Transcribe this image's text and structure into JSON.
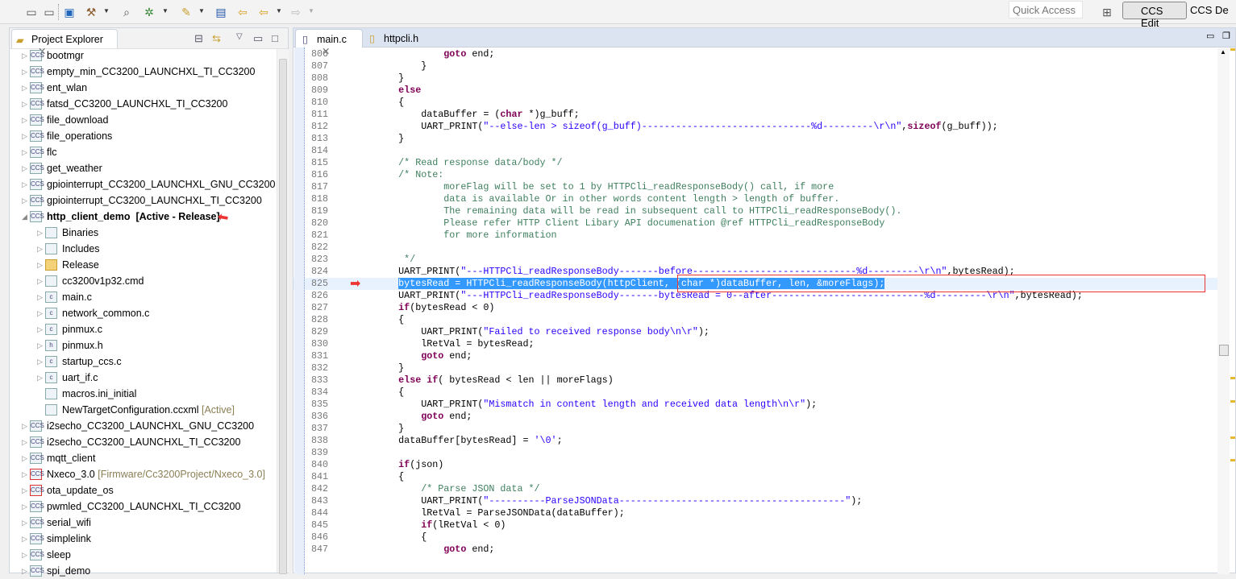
{
  "toolbar": {
    "quick_access": "Quick Access",
    "perspective_active": "CCS Edit",
    "perspective_other": "CCS De"
  },
  "explorer": {
    "title": "Project Explorer",
    "items": [
      {
        "label": "bootmgr",
        "level": 0,
        "icon": "ccs-project-icon"
      },
      {
        "label": "empty_min_CC3200_LAUNCHXL_TI_CC3200",
        "level": 0,
        "icon": "ccs-project-icon"
      },
      {
        "label": "ent_wlan",
        "level": 0,
        "icon": "ccs-project-icon"
      },
      {
        "label": "fatsd_CC3200_LAUNCHXL_TI_CC3200",
        "level": 0,
        "icon": "ccs-project-icon"
      },
      {
        "label": "file_download",
        "level": 0,
        "icon": "ccs-project-icon"
      },
      {
        "label": "file_operations",
        "level": 0,
        "icon": "ccs-project-icon"
      },
      {
        "label": "flc",
        "level": 0,
        "icon": "ccs-project-icon"
      },
      {
        "label": "get_weather",
        "level": 0,
        "icon": "ccs-project-icon"
      },
      {
        "label": "gpiointerrupt_CC3200_LAUNCHXL_GNU_CC3200",
        "level": 0,
        "icon": "ccs-project-icon"
      },
      {
        "label": "gpiointerrupt_CC3200_LAUNCHXL_TI_CC3200",
        "level": 0,
        "icon": "ccs-project-icon"
      },
      {
        "label": "http_client_demo",
        "suffix": "[Active - Release]",
        "level": 0,
        "icon": "ccs-project-icon",
        "expanded": true,
        "bold": true
      },
      {
        "label": "Binaries",
        "level": 1,
        "icon": "binaries-icon"
      },
      {
        "label": "Includes",
        "level": 1,
        "icon": "includes-icon"
      },
      {
        "label": "Release",
        "level": 1,
        "icon": "folder-icon"
      },
      {
        "label": "cc3200v1p32.cmd",
        "level": 1,
        "icon": "cmd-file-icon"
      },
      {
        "label": "main.c",
        "level": 1,
        "icon": "c-file-icon"
      },
      {
        "label": "network_common.c",
        "level": 1,
        "icon": "c-file-icon"
      },
      {
        "label": "pinmux.c",
        "level": 1,
        "icon": "c-file-icon"
      },
      {
        "label": "pinmux.h",
        "level": 1,
        "icon": "h-file-icon"
      },
      {
        "label": "startup_ccs.c",
        "level": 1,
        "icon": "c-file-icon"
      },
      {
        "label": "uart_if.c",
        "level": 1,
        "icon": "c-file-icon"
      },
      {
        "label": "macros.ini_initial",
        "level": 1,
        "icon": "file-icon",
        "leaf": true
      },
      {
        "label": "NewTargetConfiguration.ccxml",
        "suffix": "[Active]",
        "level": 1,
        "icon": "ccxml-file-icon",
        "leaf": true
      },
      {
        "label": "i2secho_CC3200_LAUNCHXL_GNU_CC3200",
        "level": 0,
        "icon": "ccs-project-icon"
      },
      {
        "label": "i2secho_CC3200_LAUNCHXL_TI_CC3200",
        "level": 0,
        "icon": "ccs-project-icon"
      },
      {
        "label": "mqtt_client",
        "level": 0,
        "icon": "ccs-project-icon"
      },
      {
        "label": "Nxeco_3.0",
        "suffix": "[Firmware/Cc3200Project/Nxeco_3.0]",
        "level": 0,
        "icon": "ccs-project-error-icon"
      },
      {
        "label": "ota_update_os",
        "level": 0,
        "icon": "ccs-project-error-icon"
      },
      {
        "label": "pwmled_CC3200_LAUNCHXL_TI_CC3200",
        "level": 0,
        "icon": "ccs-project-icon"
      },
      {
        "label": "serial_wifi",
        "level": 0,
        "icon": "ccs-project-icon"
      },
      {
        "label": "simplelink",
        "level": 0,
        "icon": "ccs-project-icon"
      },
      {
        "label": "sleep",
        "level": 0,
        "icon": "ccs-project-icon"
      },
      {
        "label": "spi_demo",
        "level": 0,
        "icon": "ccs-project-icon"
      }
    ]
  },
  "editor": {
    "tabs": [
      "main.c",
      "httpcli.h"
    ],
    "current_line": 825,
    "lines": [
      {
        "n": 806,
        "seg": [
          [
            "",
            "                    "
          ],
          [
            "k",
            "goto"
          ],
          [
            "",
            " end;"
          ]
        ]
      },
      {
        "n": 807,
        "seg": [
          [
            "",
            "                }"
          ]
        ]
      },
      {
        "n": 808,
        "seg": [
          [
            "",
            "            }"
          ]
        ]
      },
      {
        "n": 809,
        "seg": [
          [
            "",
            "            "
          ],
          [
            "k",
            "else"
          ]
        ]
      },
      {
        "n": 810,
        "seg": [
          [
            "",
            "            {"
          ]
        ]
      },
      {
        "n": 811,
        "seg": [
          [
            "",
            "                dataBuffer = ("
          ],
          [
            "k",
            "char"
          ],
          [
            "",
            " *)g_buff;"
          ]
        ]
      },
      {
        "n": 812,
        "seg": [
          [
            "",
            "                UART_PRINT("
          ],
          [
            "s",
            "\"--else-len > sizeof(g_buff)------------------------------%d---------\\r\\n\""
          ],
          [
            "",
            ","
          ],
          [
            "k",
            "sizeof"
          ],
          [
            "",
            "(g_buff));"
          ]
        ]
      },
      {
        "n": 813,
        "seg": [
          [
            "",
            "            }"
          ]
        ]
      },
      {
        "n": 814,
        "seg": [
          [
            "",
            ""
          ]
        ]
      },
      {
        "n": 815,
        "seg": [
          [
            "c",
            "            /* Read response data/body */"
          ]
        ]
      },
      {
        "n": 816,
        "seg": [
          [
            "c",
            "            /* Note:"
          ]
        ]
      },
      {
        "n": 817,
        "seg": [
          [
            "c",
            "                    moreFlag will be set to 1 by HTTPCli_readResponseBody() call, if more"
          ]
        ]
      },
      {
        "n": 818,
        "seg": [
          [
            "c",
            "                    data is available Or in other words content length > length of buffer."
          ]
        ]
      },
      {
        "n": 819,
        "seg": [
          [
            "c",
            "                    The remaining data will be read in subsequent call to HTTPCli_readResponseBody()."
          ]
        ]
      },
      {
        "n": 820,
        "seg": [
          [
            "c",
            "                    Please refer HTTP Client Libary API documenation @ref HTTPCli_readResponseBody"
          ]
        ]
      },
      {
        "n": 821,
        "seg": [
          [
            "c",
            "                    for more information"
          ]
        ]
      },
      {
        "n": 822,
        "seg": [
          [
            "",
            ""
          ]
        ]
      },
      {
        "n": 823,
        "seg": [
          [
            "c",
            "             */"
          ]
        ]
      },
      {
        "n": 824,
        "seg": [
          [
            "",
            "            UART_PRINT("
          ],
          [
            "s",
            "\"---HTTPCli_readResponseBody-------before-----------------------------%d---------\\r\\n\""
          ],
          [
            "",
            ",bytesRead);"
          ]
        ]
      },
      {
        "n": 825,
        "seg": [
          [
            "",
            "            "
          ],
          [
            "sel",
            "bytesRead = HTTPCli_readResponseBody(httpClient, (char *)dataBuffer, len, &moreFlags);"
          ]
        ]
      },
      {
        "n": 826,
        "seg": [
          [
            "",
            "            UART_PRINT("
          ],
          [
            "s",
            "\"---HTTPCli_readResponseBody-------bytesRead = 0--after---------------------------%d---------\\r\\n\""
          ],
          [
            "",
            ",bytesRead);"
          ]
        ]
      },
      {
        "n": 827,
        "seg": [
          [
            "",
            "            "
          ],
          [
            "k",
            "if"
          ],
          [
            "",
            "(bytesRead < 0)"
          ]
        ]
      },
      {
        "n": 828,
        "seg": [
          [
            "",
            "            {"
          ]
        ]
      },
      {
        "n": 829,
        "seg": [
          [
            "",
            "                UART_PRINT("
          ],
          [
            "s",
            "\"Failed to received response body\\n\\r\""
          ],
          [
            "",
            ");"
          ]
        ]
      },
      {
        "n": 830,
        "seg": [
          [
            "",
            "                lRetVal = bytesRead;"
          ]
        ]
      },
      {
        "n": 831,
        "seg": [
          [
            "",
            "                "
          ],
          [
            "k",
            "goto"
          ],
          [
            "",
            " end;"
          ]
        ]
      },
      {
        "n": 832,
        "seg": [
          [
            "",
            "            }"
          ]
        ]
      },
      {
        "n": 833,
        "seg": [
          [
            "",
            "            "
          ],
          [
            "k",
            "else if"
          ],
          [
            "",
            "( bytesRead < len || moreFlags)"
          ]
        ]
      },
      {
        "n": 834,
        "seg": [
          [
            "",
            "            {"
          ]
        ]
      },
      {
        "n": 835,
        "seg": [
          [
            "",
            "                UART_PRINT("
          ],
          [
            "s",
            "\"Mismatch in content length and received data length\\n\\r\""
          ],
          [
            "",
            ");"
          ]
        ]
      },
      {
        "n": 836,
        "seg": [
          [
            "",
            "                "
          ],
          [
            "k",
            "goto"
          ],
          [
            "",
            " end;"
          ]
        ]
      },
      {
        "n": 837,
        "seg": [
          [
            "",
            "            }"
          ]
        ]
      },
      {
        "n": 838,
        "seg": [
          [
            "",
            "            dataBuffer[bytesRead] = "
          ],
          [
            "s",
            "'\\0'"
          ],
          [
            "",
            ";"
          ]
        ]
      },
      {
        "n": 839,
        "seg": [
          [
            "",
            ""
          ]
        ]
      },
      {
        "n": 840,
        "seg": [
          [
            "",
            "            "
          ],
          [
            "k",
            "if"
          ],
          [
            "",
            "(json)"
          ]
        ]
      },
      {
        "n": 841,
        "seg": [
          [
            "",
            "            {"
          ]
        ]
      },
      {
        "n": 842,
        "seg": [
          [
            "c",
            "                /* Parse JSON data */"
          ]
        ]
      },
      {
        "n": 843,
        "seg": [
          [
            "",
            "                UART_PRINT("
          ],
          [
            "s",
            "\"----------ParseJSONData----------------------------------------\""
          ],
          [
            "",
            ");"
          ]
        ]
      },
      {
        "n": 844,
        "seg": [
          [
            "",
            "                lRetVal = ParseJSONData(dataBuffer);"
          ]
        ]
      },
      {
        "n": 845,
        "seg": [
          [
            "",
            "                "
          ],
          [
            "k",
            "if"
          ],
          [
            "",
            "(lRetVal < 0)"
          ]
        ]
      },
      {
        "n": 846,
        "seg": [
          [
            "",
            "                {"
          ]
        ]
      },
      {
        "n": 847,
        "seg": [
          [
            "",
            "                    "
          ],
          [
            "k",
            "goto"
          ],
          [
            "",
            " end;"
          ]
        ]
      }
    ]
  }
}
